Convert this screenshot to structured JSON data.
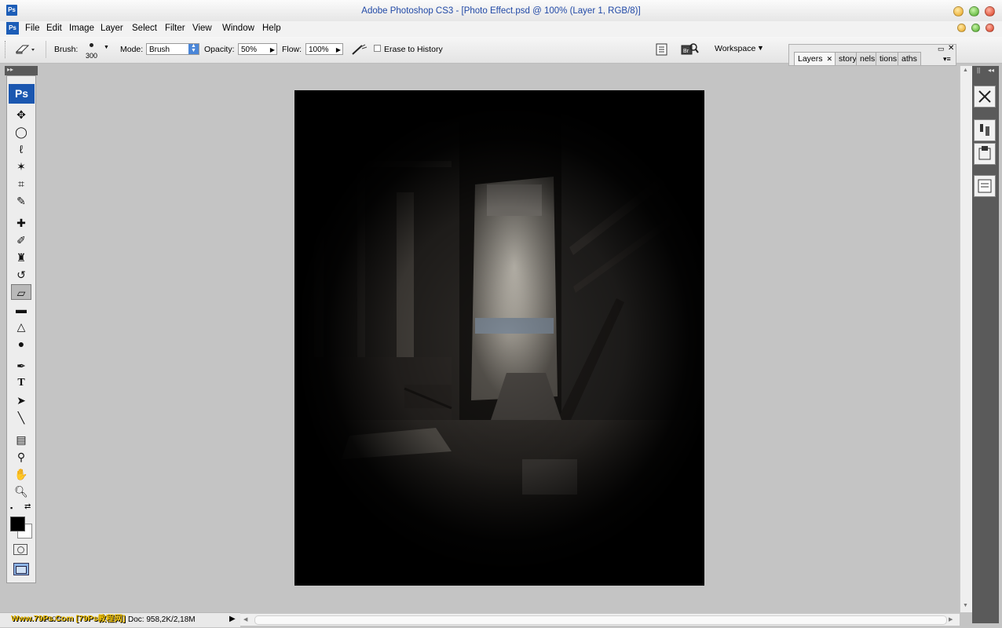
{
  "window": {
    "title": "Adobe Photoshop CS3 - [Photo Effect.psd @ 100% (Layer 1, RGB/8)]",
    "app_icon": "Ps"
  },
  "menu": [
    "File",
    "Edit",
    "Image",
    "Layer",
    "Select",
    "Filter",
    "View",
    "Window",
    "Help"
  ],
  "options": {
    "brush_label": "Brush:",
    "brush_size": "300",
    "mode_label": "Mode:",
    "mode_value": "Brush",
    "opacity_label": "Opacity:",
    "opacity_value": "50%",
    "flow_label": "Flow:",
    "flow_value": "100%",
    "erase_history_label": "Erase to History",
    "workspace_label": "Workspace"
  },
  "panels": {
    "tabs": [
      "Layers",
      "story",
      "nels",
      "tions",
      "aths"
    ]
  },
  "tools": {
    "logo": "Ps",
    "icons": [
      "move-icon",
      "marquee-icon",
      "lasso-icon",
      "magic-wand-icon",
      "crop-icon",
      "slice-icon",
      "healing-brush-icon",
      "brush-icon",
      "clone-stamp-icon",
      "history-brush-icon",
      "eraser-icon",
      "gradient-icon",
      "blur-icon",
      "dodge-icon",
      "pen-icon",
      "type-icon",
      "path-selection-icon",
      "line-icon",
      "notes-icon",
      "eyedropper-icon",
      "hand-icon",
      "zoom-icon"
    ]
  },
  "status": {
    "zoom": "100%",
    "doc_info": "Doc: 958,2K/2,18M",
    "watermark": "Www.79Ps.Com [79Ps教程网]"
  },
  "colors": {
    "title_text": "#2149a6",
    "ps_blue": "#1c5db7",
    "foreground": "#000000",
    "background": "#ffffff"
  }
}
